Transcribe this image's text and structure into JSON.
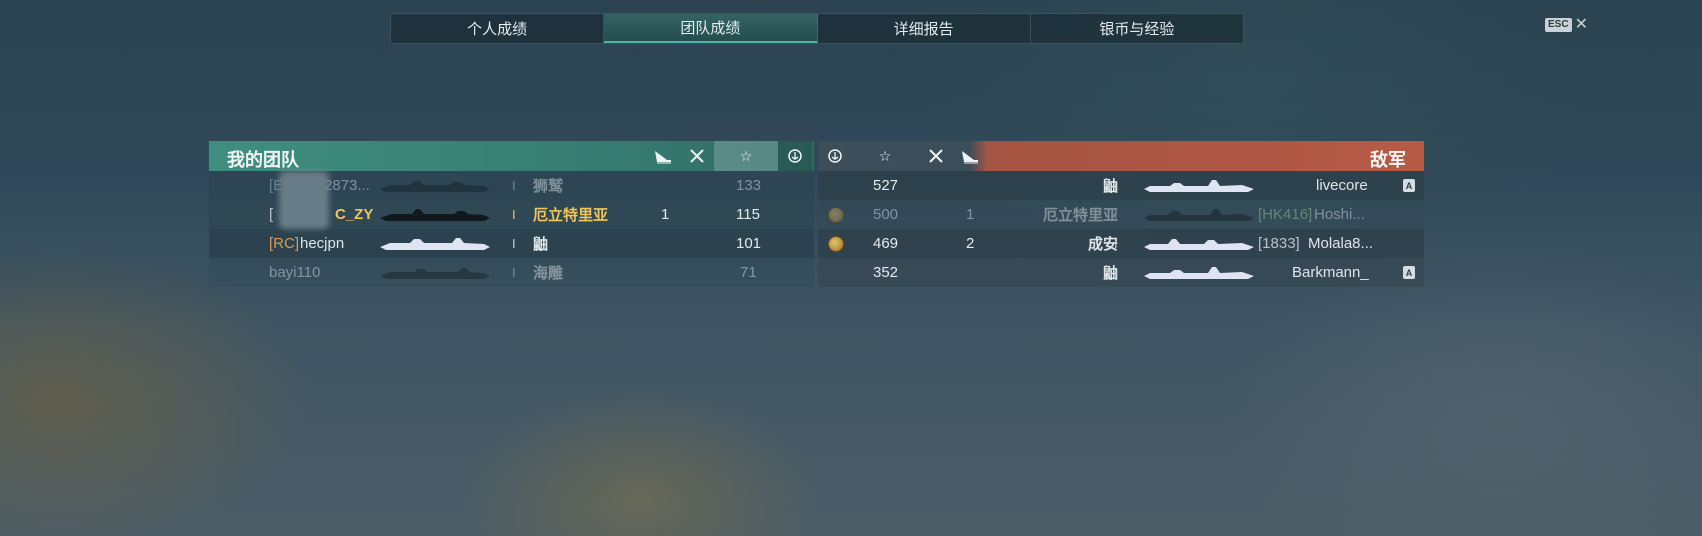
{
  "tabs": [
    "个人成绩",
    "团队成绩",
    "详细报告",
    "银币与经验"
  ],
  "esc_label": "ESC",
  "close_glyph": "✕",
  "ally": {
    "title": "我的团队",
    "header_icons": [
      "torpedo-icon",
      "plane-icon",
      "star-icon",
      "anchor-icon"
    ],
    "players": [
      {
        "clan": "[E",
        "name": "2873...",
        "ship": "狮鹫",
        "tier": "I",
        "kills": "",
        "score": "133",
        "dead": true
      },
      {
        "clan": "[",
        "name": "C_ZY",
        "ship": "厄立特里亚",
        "tier": "I",
        "kills": "1",
        "score": "115",
        "dead": false,
        "highlight": true
      },
      {
        "clan": "[RC]",
        "name": "hecjpn",
        "ship": "鼬",
        "tier": "I",
        "kills": "",
        "score": "101",
        "dead": false
      },
      {
        "clan": "",
        "name": "bayi110",
        "ship": "海雕",
        "tier": "I",
        "kills": "",
        "score": "71",
        "dead": true
      }
    ]
  },
  "enemy": {
    "title": "敌军",
    "header_icons": [
      "anchor-icon",
      "star-icon",
      "plane-icon",
      "torpedo-icon"
    ],
    "players": [
      {
        "clan": "",
        "name": "livecore",
        "ship": "鼬",
        "tier": "I",
        "kills": "",
        "score": "527",
        "medal": false,
        "badge": "A",
        "dead": false
      },
      {
        "clan": "[HK416]",
        "name": "Hoshi...",
        "ship": "厄立特里亚",
        "tier": "I",
        "kills": "1",
        "score": "500",
        "medal": true,
        "badge": "",
        "dead": true
      },
      {
        "clan": "[1833]",
        "name": "Molala8...",
        "ship": "成安",
        "tier": "I",
        "kills": "2",
        "score": "469",
        "medal": true,
        "badge": "",
        "dead": false
      },
      {
        "clan": "",
        "name": "Barkmann_",
        "ship": "鼬",
        "tier": "I",
        "kills": "",
        "score": "352",
        "medal": false,
        "badge": "A",
        "dead": false
      }
    ]
  },
  "colors": {
    "ally_header": "#3f8f80",
    "enemy_header": "#b65a46",
    "highlight": "#f0c55a"
  }
}
